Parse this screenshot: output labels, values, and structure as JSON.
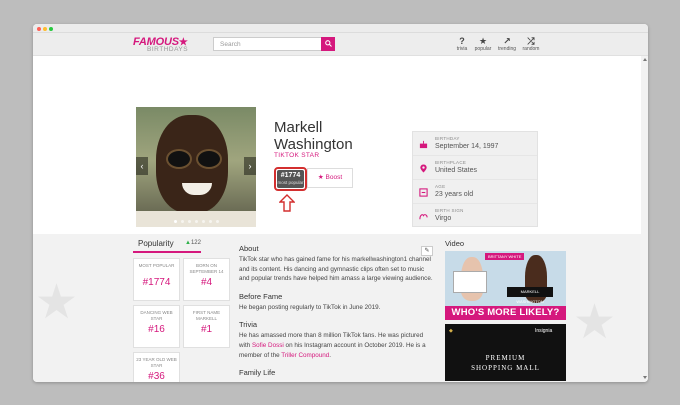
{
  "header": {
    "logo_top": "FAMOUS",
    "logo_bottom": "BIRTHDAYS",
    "search_placeholder": "Search",
    "nav": [
      {
        "icon": "?",
        "label": "trivia"
      },
      {
        "icon": "★",
        "label": "popular"
      },
      {
        "icon": "↗",
        "label": "trending"
      },
      {
        "icon": "⤮",
        "label": "random"
      }
    ]
  },
  "profile": {
    "first_name": "Markell",
    "last_name": "Washington",
    "role": "TIKTOK STAR",
    "rank_number": "#1774",
    "rank_label": "most popular",
    "boost_label": "Boost"
  },
  "facts": [
    {
      "label": "BIRTHDAY",
      "value": "September 14, 1997"
    },
    {
      "label": "BIRTHPLACE",
      "value": "United States"
    },
    {
      "label": "AGE",
      "value": "23 years old"
    },
    {
      "label": "BIRTH SIGN",
      "value": "Virgo"
    }
  ],
  "popularity": {
    "title": "Popularity",
    "count": "122",
    "cards": [
      {
        "label": "MOST POPULAR",
        "value": "#1774"
      },
      {
        "label": "BORN ON SEPTEMBER 14",
        "value": "#4"
      },
      {
        "label": "DANCING WEB STAR",
        "value": "#16"
      },
      {
        "label": "FIRST NAME MARKELL",
        "value": "#1"
      },
      {
        "label": "23 YEAR OLD WEB STAR",
        "value": "#36"
      }
    ]
  },
  "about": {
    "title": "About",
    "text": "TikTok star who has gained fame for his markellwashington1 channel and its content. His dancing and gymnastic clips often set to music and popular trends have helped him amass a large viewing audience.",
    "before_fame_title": "Before Fame",
    "before_fame_text": "He began posting regularly to TikTok in June 2019.",
    "trivia_title": "Trivia",
    "trivia_text_1": "He has amassed more than 8 million TikTok fans. He was pictured with ",
    "trivia_link_1": "Sofie Dossi",
    "trivia_text_2": " on his Instagram account in October 2019. He is a member of the ",
    "trivia_link_2": "Triller Compound",
    "trivia_text_3": ".",
    "family_title": "Family Life"
  },
  "video": {
    "title": "Video",
    "thumb1_badge": "BRITTANY WHITE",
    "thumb1_name_board": "MARKELL WASHINGTON",
    "thumb1_banner": "WHO'S MORE LIKELY?",
    "thumb2_line1": "PREMIUM",
    "thumb2_line2": "SHOPPING MALL",
    "thumb2_brand": "Insignia"
  }
}
